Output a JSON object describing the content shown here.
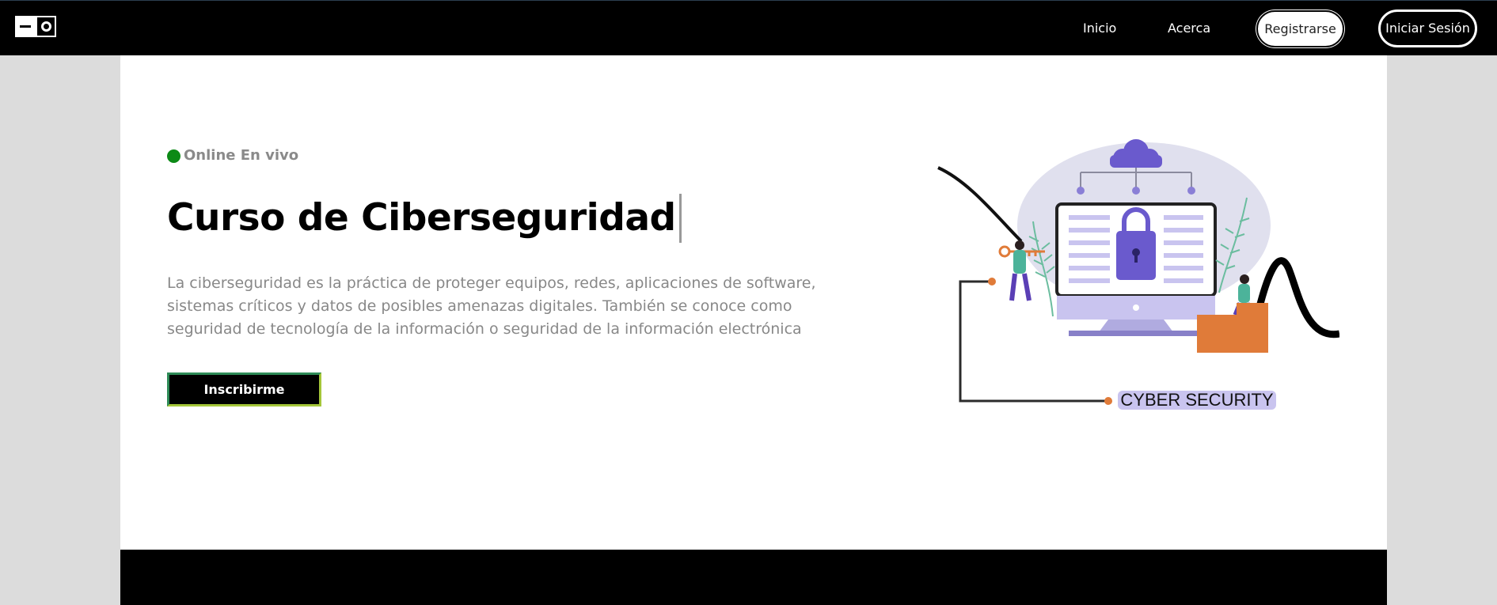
{
  "nav": {
    "logo_icon": "square-dash-circle-logo",
    "links": {
      "inicio": "Inicio",
      "acerca": "Acerca"
    },
    "register_label": "Registrarse",
    "login_label": "Iniciar Sesión"
  },
  "hero": {
    "status_color": "#0c8a16",
    "status_label": "Online En vivo",
    "title": "Curso de Ciberseguridad",
    "description": "La ciberseguridad es la práctica de proteger equipos, redes, aplicaciones de software, sistemas críticos y datos de posibles amenazas digitales. También se conoce como seguridad de tecnología de la información o seguridad de la información electrónica",
    "cta_label": "Inscribirme"
  },
  "illustration": {
    "caption": "CYBER SECURITY",
    "accent": "#6a5acd",
    "orange": "#e07b39"
  }
}
